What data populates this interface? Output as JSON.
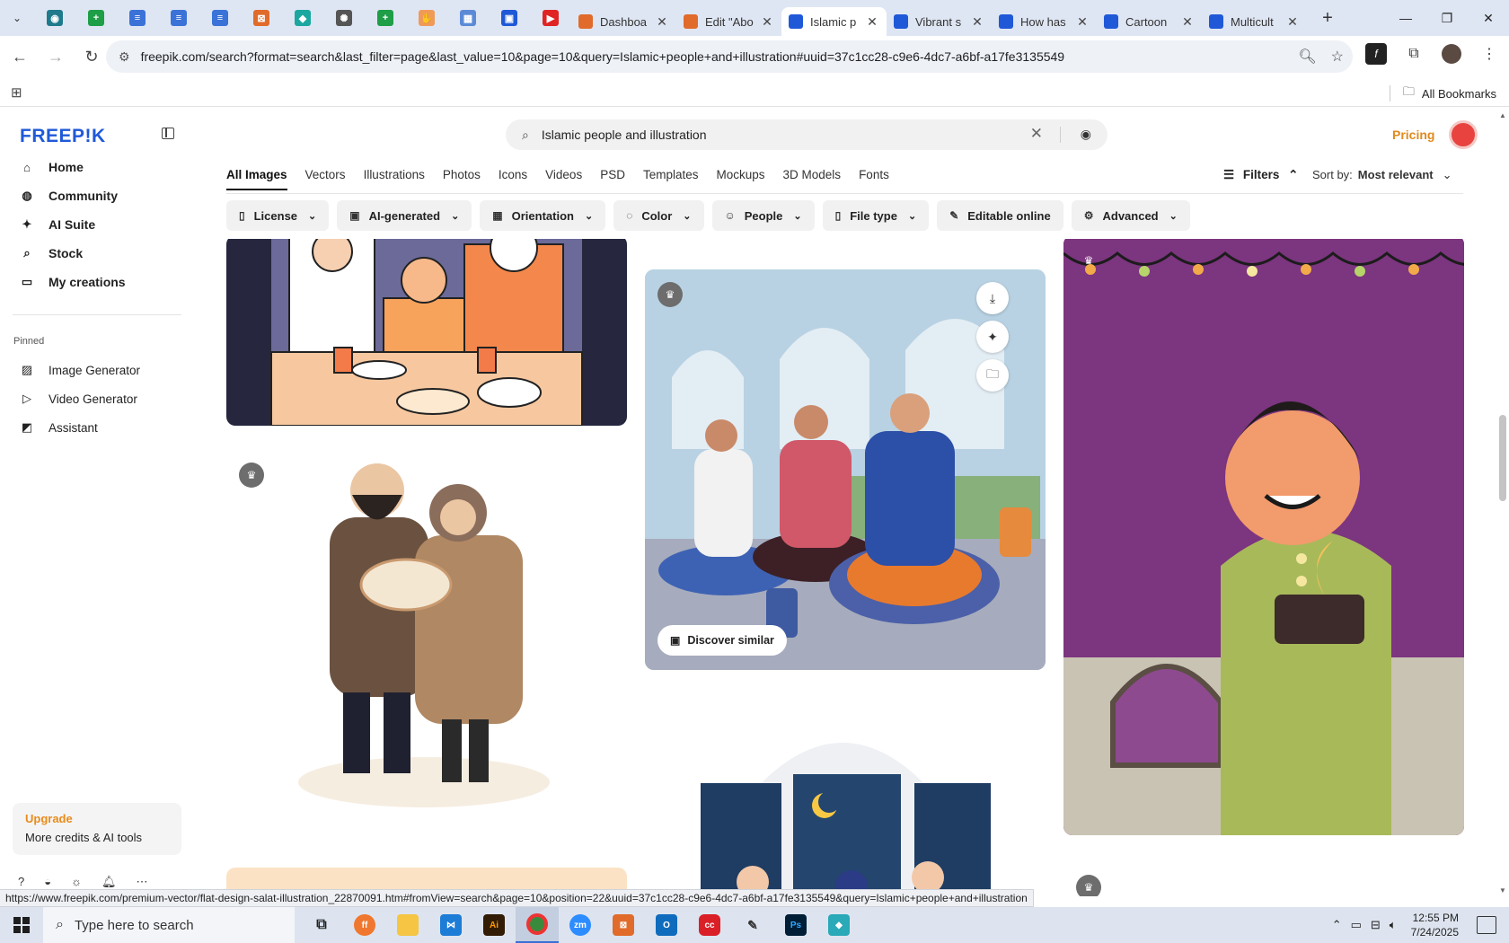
{
  "browser": {
    "tabs": [
      {
        "title": "Dashboa",
        "color": "#e06b2b",
        "active": false
      },
      {
        "title": "Edit \"Abo",
        "color": "#e06b2b",
        "active": false
      },
      {
        "title": "Islamic p",
        "color": "#1f59d8",
        "active": true
      },
      {
        "title": "Vibrant s",
        "color": "#1f59d8",
        "active": false
      },
      {
        "title": "How has",
        "color": "#1f59d8",
        "active": false
      },
      {
        "title": "Cartoon",
        "color": "#1f59d8",
        "active": false
      },
      {
        "title": "Multicult",
        "color": "#1f59d8",
        "active": false
      }
    ],
    "url": "freepik.com/search?format=search&last_filter=page&last_value=10&page=10&query=Islamic+people+and+illustration#uuid=37c1cc28-c9e6-4dc7-a6bf-a17fe3135549",
    "all_bookmarks": "All Bookmarks"
  },
  "sidebar": {
    "logo": "FREEP!K",
    "nav": [
      "Home",
      "Community",
      "AI Suite",
      "Stock",
      "My creations"
    ],
    "pinned_label": "Pinned",
    "pinned": [
      "Image Generator",
      "Video Generator",
      "Assistant"
    ],
    "upgrade_title": "Upgrade",
    "upgrade_sub": "More credits & AI tools"
  },
  "header": {
    "search_query": "Islamic people and illustration",
    "pricing": "Pricing"
  },
  "categories": [
    "All Images",
    "Vectors",
    "Illustrations",
    "Photos",
    "Icons",
    "Videos",
    "PSD",
    "Templates",
    "Mockups",
    "3D Models",
    "Fonts"
  ],
  "filters_label": "Filters",
  "sort_label": "Sort by:",
  "sort_value": "Most relevant",
  "chips": [
    "License",
    "AI-generated",
    "Orientation",
    "Color",
    "People",
    "File type",
    "Editable online",
    "Advanced"
  ],
  "grid": {
    "discover_label": "Discover similar"
  },
  "status_url": "https://www.freepik.com/premium-vector/flat-design-salat-illustration_22870091.htm#fromView=search&page=10&position=22&uuid=37c1cc28-c9e6-4dc7-a6bf-a17fe3135549&query=Islamic+people+and+illustration",
  "taskbar": {
    "search_placeholder": "Type here to search",
    "time": "12:55 PM",
    "date": "7/24/2025"
  }
}
